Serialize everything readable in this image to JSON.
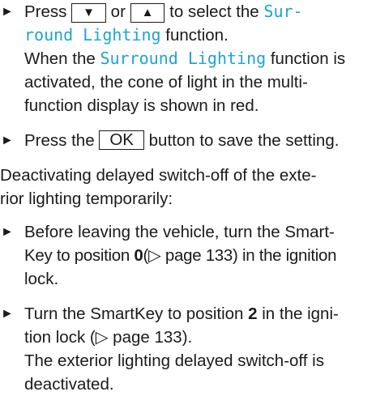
{
  "step1": {
    "arrow": "►",
    "t1": "Press",
    "key_down": "▼",
    "or": "or",
    "key_up": "▲",
    "t2": "to select the",
    "fn_a": "Sur-",
    "fn_b": "round Lighting",
    "t3": "function.",
    "r1": "When the",
    "fn2": "Surround Lighting",
    "r2": "function is",
    "r3": "activated, the cone of light in the multi-",
    "r4": "function display is shown in red."
  },
  "step2": {
    "arrow": "►",
    "t1": "Press the",
    "key_ok": "OK",
    "t2": "button to save the setting."
  },
  "heading": {
    "l1": "Deactivating delayed switch-off of the exte-",
    "l2": "rior lighting temporarily:"
  },
  "step3": {
    "arrow": "►",
    "l1": "Before leaving the vehicle, turn the Smart-",
    "l2a": "Key to position",
    "pos": "0",
    "ref": "(▷ page 133)",
    "l2b": "in the ignition",
    "l3": "lock."
  },
  "step4": {
    "arrow": "►",
    "l1a": "Turn the SmartKey to position",
    "pos": "2",
    "l1b": "in the igni-",
    "l2": "tion lock (▷ page 133).",
    "r1": "The exterior lighting delayed switch-off is",
    "r2": "deactivated."
  }
}
